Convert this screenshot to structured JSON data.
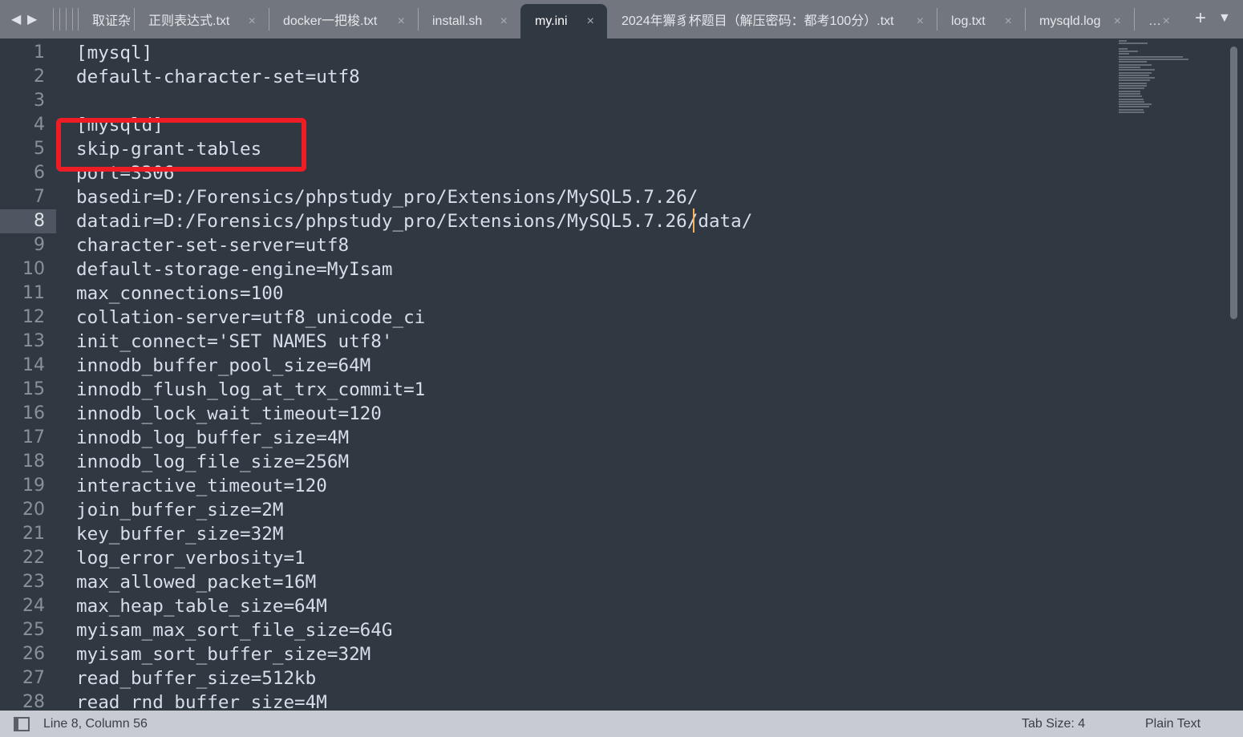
{
  "tabs": [
    {
      "label": "取证杂",
      "closable": false
    },
    {
      "label": "正则表达式.txt"
    },
    {
      "label": "docker一把梭.txt"
    },
    {
      "label": "install.sh"
    },
    {
      "label": "my.ini",
      "active": true
    },
    {
      "label": "2024年獬豸杯题目（解压密码：都考100分）.txt"
    },
    {
      "label": "log.txt"
    },
    {
      "label": "mysqld.log"
    },
    {
      "label": "…"
    }
  ],
  "icons": {
    "back": "◀",
    "forward": "▶",
    "close": "×",
    "new_tab": "+",
    "tab_menu": "▼"
  },
  "editor": {
    "current_line": 8,
    "highlight_color": "#ee1c25",
    "lines": [
      "[mysql]",
      "default-character-set=utf8",
      "",
      "[mysqld]",
      "skip-grant-tables",
      "port=3306",
      "basedir=D:/Forensics/phpstudy_pro/Extensions/MySQL5.7.26/",
      "datadir=D:/Forensics/phpstudy_pro/Extensions/MySQL5.7.26/data/",
      "character-set-server=utf8",
      "default-storage-engine=MyIsam",
      "max_connections=100",
      "collation-server=utf8_unicode_ci",
      "init_connect='SET NAMES utf8'",
      "innodb_buffer_pool_size=64M",
      "innodb_flush_log_at_trx_commit=1",
      "innodb_lock_wait_timeout=120",
      "innodb_log_buffer_size=4M",
      "innodb_log_file_size=256M",
      "interactive_timeout=120",
      "join_buffer_size=2M",
      "key_buffer_size=32M",
      "log_error_verbosity=1",
      "max_allowed_packet=16M",
      "max_heap_table_size=64M",
      "myisam_max_sort_file_size=64G",
      "myisam_sort_buffer_size=32M",
      "read_buffer_size=512kb",
      "read_rnd_buffer_size=4M"
    ]
  },
  "status": {
    "position": "Line 8, Column 56",
    "tab_size": "Tab Size: 4",
    "syntax": "Plain Text"
  }
}
